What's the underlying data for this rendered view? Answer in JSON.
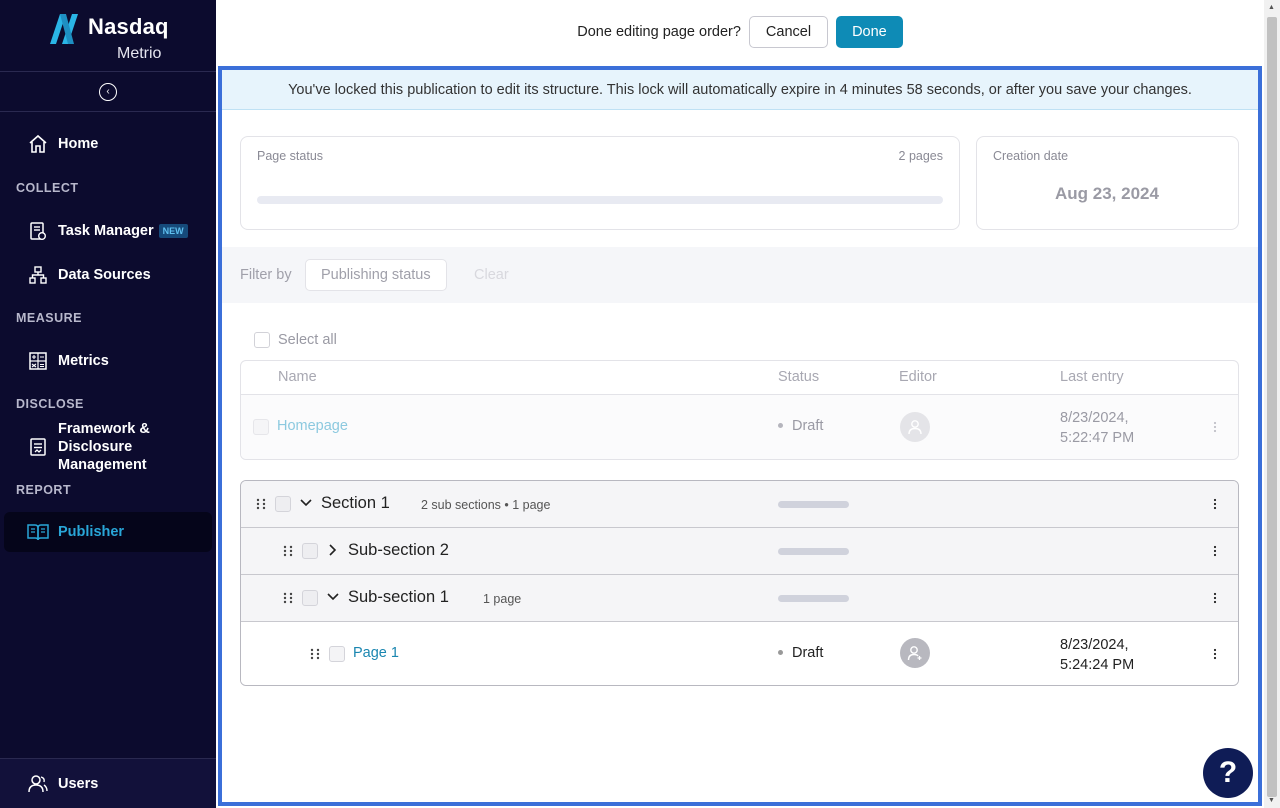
{
  "brand": {
    "name": "Nasdaq",
    "product": "Metrio",
    "logo": "nasdaq-logo"
  },
  "sidebar": {
    "collapse_icon": "chevron-left-circle-icon",
    "sections": {
      "collect": "COLLECT",
      "measure": "MEASURE",
      "disclose": "DISCLOSE",
      "report": "REPORT"
    },
    "items": [
      {
        "label": "Home",
        "icon": "home-icon"
      },
      {
        "label": "Task Manager",
        "icon": "task-icon",
        "badge": "NEW"
      },
      {
        "label": "Data Sources",
        "icon": "data-sources-icon"
      },
      {
        "label": "Metrics",
        "icon": "calculator-icon"
      },
      {
        "label": "Framework &",
        "label2": "Disclosure",
        "label3": "Management",
        "icon": "document-icon"
      },
      {
        "label": "Publisher",
        "icon": "book-icon",
        "active": true
      }
    ],
    "users": {
      "label": "Users",
      "icon": "users-icon"
    }
  },
  "topbar": {
    "prompt": "Done editing page order?",
    "cancel_label": "Cancel",
    "done_label": "Done"
  },
  "lock_banner": "You've locked this publication to edit its structure. This lock will automatically expire in 4 minutes 58 seconds, or after you save your changes.",
  "page_status": {
    "label": "Page status",
    "count": "2 pages"
  },
  "creation": {
    "label": "Creation date",
    "value": "Aug 23, 2024"
  },
  "filter": {
    "label": "Filter by",
    "button": "Publishing status",
    "clear": "Clear"
  },
  "select_all": "Select all",
  "table": {
    "headers": {
      "name": "Name",
      "status": "Status",
      "editor": "Editor",
      "last_entry": "Last entry"
    },
    "homepage": {
      "name": "Homepage",
      "status": "Draft",
      "date": "8/23/2024,",
      "time": "5:22:47 PM"
    }
  },
  "tree": [
    {
      "title": "Section 1",
      "meta": "2 sub sections • 1 page",
      "expanded": true
    },
    {
      "title": "Sub-section 2",
      "meta": "",
      "expanded": false
    },
    {
      "title": "Sub-section 1",
      "meta": "1 page",
      "expanded": true
    },
    {
      "title": "Page 1",
      "status": "Draft",
      "date": "8/23/2024,",
      "time": "5:24:24 PM"
    }
  ],
  "help": {
    "label": "?",
    "icon": "help-icon"
  },
  "colors": {
    "sidebar_bg": "#0c0b2e",
    "accent": "#0e8bb6",
    "frame_border": "#3b6fd9",
    "active_nav": "#29a6d8"
  }
}
